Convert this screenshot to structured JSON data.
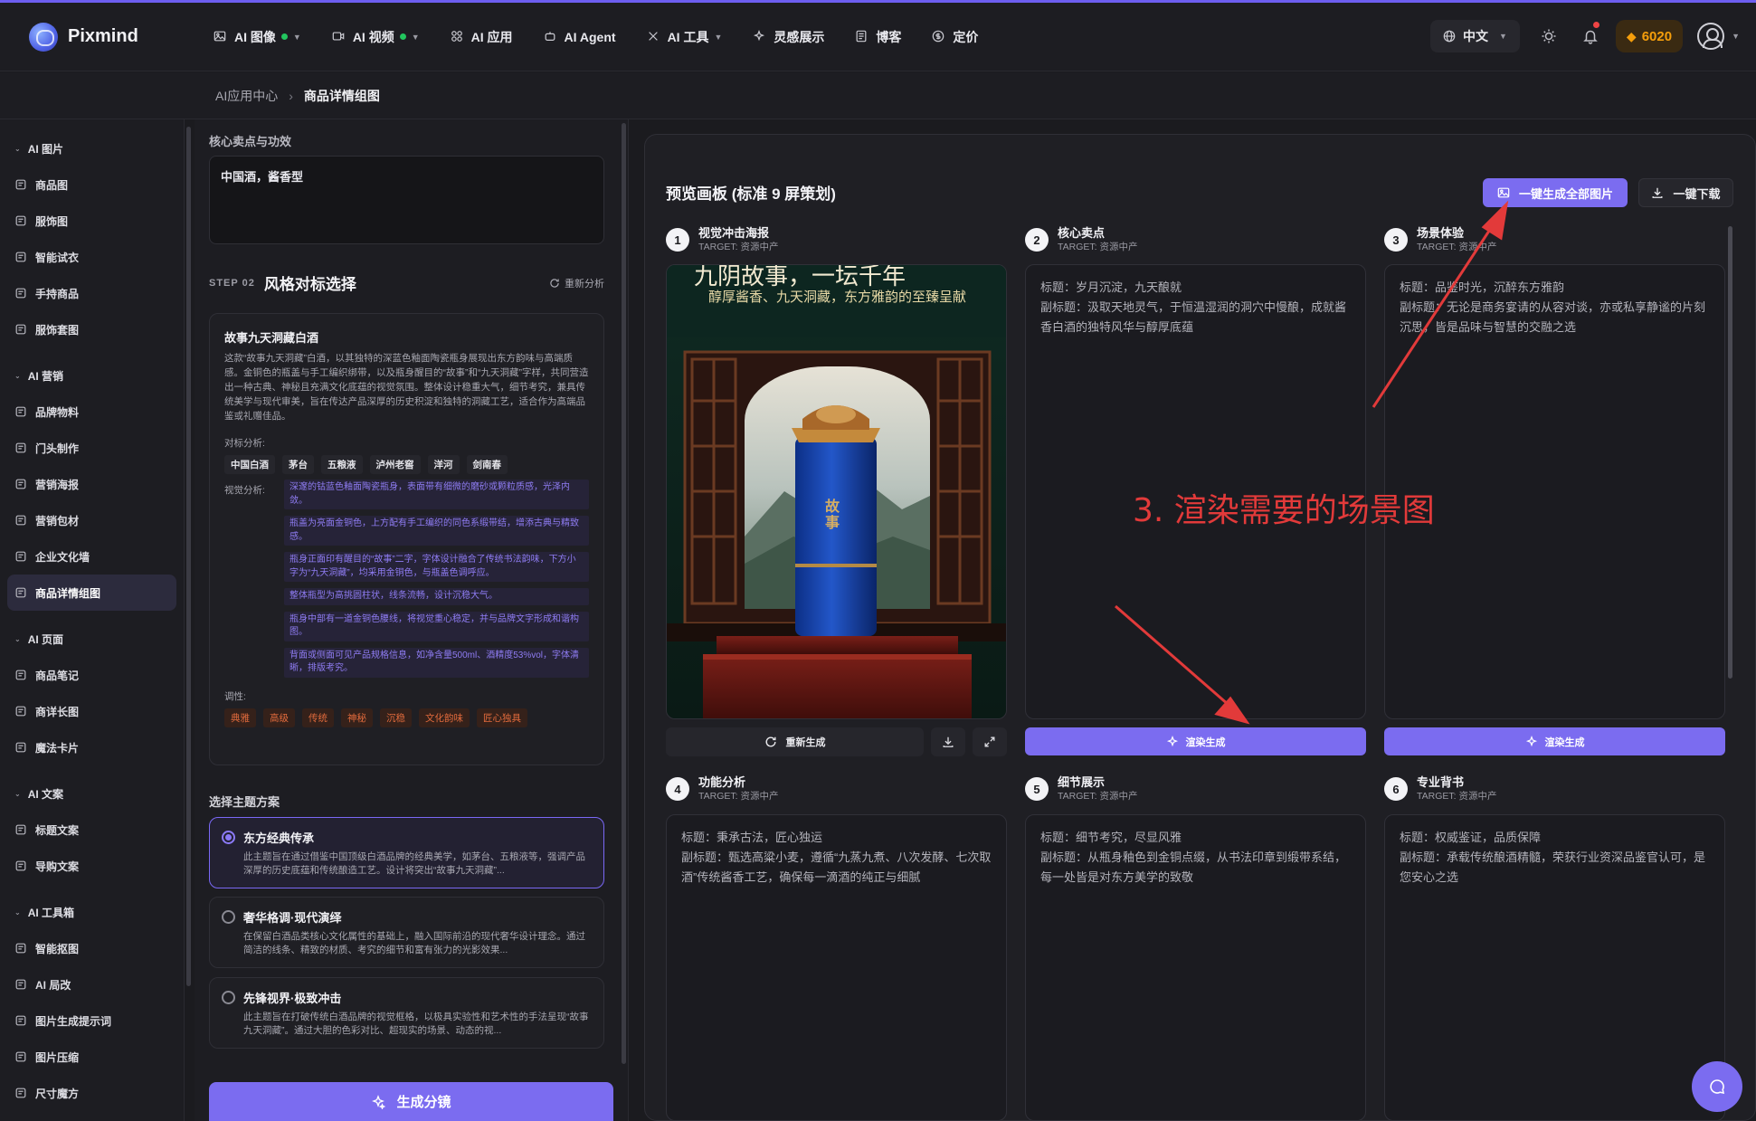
{
  "brand": {
    "name": "Pixmind"
  },
  "nav": {
    "items": [
      {
        "label": "AI 图像",
        "icon": "image-icon",
        "dot": true,
        "chevron": true
      },
      {
        "label": "AI 视频",
        "icon": "video-icon",
        "dot": true,
        "chevron": true
      },
      {
        "label": "AI 应用",
        "icon": "apps-icon",
        "dot": false,
        "chevron": false
      },
      {
        "label": "AI Agent",
        "icon": "robot-icon",
        "dot": false,
        "chevron": false
      },
      {
        "label": "AI 工具",
        "icon": "tools-icon",
        "dot": false,
        "chevron": true
      },
      {
        "label": "灵感展示",
        "icon": "sparkle-icon",
        "dot": false,
        "chevron": false
      },
      {
        "label": "博客",
        "icon": "blog-icon",
        "dot": false,
        "chevron": false
      },
      {
        "label": "定价",
        "icon": "price-icon",
        "dot": false,
        "chevron": false
      }
    ],
    "language": "中文",
    "credits": "6020"
  },
  "breadcrumb": {
    "parent": "AI应用中心",
    "current": "商品详情组图"
  },
  "sidebar": {
    "groups": [
      {
        "label": "AI 图片",
        "items": [
          {
            "label": "商品图",
            "icon": "product-icon"
          },
          {
            "label": "服饰图",
            "icon": "shirt-icon"
          },
          {
            "label": "智能试衣",
            "icon": "hanger-icon"
          },
          {
            "label": "手持商品",
            "icon": "hand-icon"
          },
          {
            "label": "服饰套图",
            "icon": "grid-icon"
          }
        ]
      },
      {
        "label": "AI 营销",
        "items": [
          {
            "label": "品牌物料",
            "icon": "palette-icon"
          },
          {
            "label": "门头制作",
            "icon": "storefront-icon"
          },
          {
            "label": "营销海报",
            "icon": "poster-icon"
          },
          {
            "label": "营销包材",
            "icon": "package-icon"
          },
          {
            "label": "企业文化墙",
            "icon": "wall-icon"
          },
          {
            "label": "商品详情组图",
            "icon": "gallery-icon",
            "active": true
          }
        ]
      },
      {
        "label": "AI 页面",
        "items": [
          {
            "label": "商品笔记",
            "icon": "note-icon"
          },
          {
            "label": "商详长图",
            "icon": "longpage-icon"
          },
          {
            "label": "魔法卡片",
            "icon": "magic-icon"
          }
        ]
      },
      {
        "label": "AI 文案",
        "items": [
          {
            "label": "标题文案",
            "icon": "pen-icon"
          },
          {
            "label": "导购文案",
            "icon": "doc-icon"
          }
        ]
      },
      {
        "label": "AI 工具箱",
        "items": [
          {
            "label": "智能抠图",
            "icon": "scissors-icon"
          },
          {
            "label": "AI 局改",
            "icon": "brush-icon"
          },
          {
            "label": "图片生成提示词",
            "icon": "bulb-icon"
          },
          {
            "label": "图片压缩",
            "icon": "compress-icon"
          },
          {
            "label": "尺寸魔方",
            "icon": "crop-icon"
          }
        ]
      }
    ]
  },
  "form": {
    "core_label": "核心卖点与功效",
    "core_value": "中国酒，酱香型",
    "step_small": "STEP 02",
    "step_title": "风格对标选择",
    "reanalyze": "重新分析",
    "analysis": {
      "title": "故事九天洞藏白酒",
      "desc": "这款“故事九天洞藏”白酒，以其独特的深蓝色釉面陶瓷瓶身展现出东方韵味与高端质感。金铜色的瓶盖与手工编织绑带，以及瓶身醒目的“故事”和“九天洞藏”字样，共同营造出一种古典、神秘且充满文化底蕴的视觉氛围。整体设计稳重大气，细节考究，兼具传统美学与现代审美，旨在传达产品深厚的历史积淀和独特的洞藏工艺，适合作为高端品鉴或礼赠佳品。",
      "competitors_label": "对标分析:",
      "competitors": [
        "中国白酒",
        "茅台",
        "五粮液",
        "泸州老窖",
        "洋河",
        "剑南春"
      ],
      "visual_label": "视觉分析:",
      "visual_items": [
        "深邃的钴蓝色釉面陶瓷瓶身，表面带有细微的磨砂或颗粒质感，光泽内敛。",
        "瓶盖为亮面金铜色，上方配有手工编织的同色系缎带结，增添古典与精致感。",
        "瓶身正面印有醒目的“故事”二字，字体设计融合了传统书法韵味，下方小字为“九天洞藏”，均采用金铜色，与瓶盖色调呼应。",
        "整体瓶型为高挑圆柱状，线条流畅，设计沉稳大气。",
        "瓶身中部有一道金铜色腰线，将视觉重心稳定，并与品牌文字形成和谐构图。",
        "背面或侧面可见产品规格信息，如净含量500ml、酒精度53%vol，字体清晰，排版考究。"
      ],
      "tone_label": "调性:",
      "tones": [
        "典雅",
        "高级",
        "传统",
        "神秘",
        "沉稳",
        "文化韵味",
        "匠心独具"
      ]
    },
    "theme_label": "选择主题方案",
    "themes": [
      {
        "title": "东方经典传承",
        "desc": "此主题旨在通过借鉴中国顶级白酒品牌的经典美学，如茅台、五粮液等，强调产品深厚的历史底蕴和传统酿造工艺。设计将突出“故事九天洞藏”...",
        "selected": true
      },
      {
        "title": "奢华格调·现代演绎",
        "desc": "在保留白酒品类核心文化属性的基础上，融入国际前沿的现代奢华设计理念。通过简洁的线条、精致的材质、考究的细节和富有张力的光影效果...",
        "selected": false
      },
      {
        "title": "先锋视界·极致冲击",
        "desc": "此主题旨在打破传统白酒品牌的视觉框格，以极具实验性和艺术性的手法呈现“故事九天洞藏”。通过大胆的色彩对比、超现实的场景、动态的视...",
        "selected": false
      }
    ],
    "generate_button": "生成分镜"
  },
  "preview": {
    "title": "预览画板 (标准 9 屏策划)",
    "generate_all": "一键生成全部图片",
    "download_all": "一键下载",
    "regenerate": "重新生成",
    "render_label": "渲染生成",
    "poster_text_top": "九阴故事，一坛千年",
    "poster_subtitle": "醇厚酱香、九天洞藏，东方雅韵的至臻呈献",
    "bottle_label": "故事",
    "cards": [
      {
        "num": "1",
        "title": "视觉冲击海报",
        "target": "TARGET: 资源中产",
        "headline": "",
        "subhead": ""
      },
      {
        "num": "2",
        "title": "核心卖点",
        "target": "TARGET: 资源中产",
        "headline": "标题：岁月沉淀，九天酿就",
        "subhead": "副标题：汲取天地灵气，于恒温湿润的洞穴中慢酿，成就酱香白酒的独特风华与醇厚底蕴"
      },
      {
        "num": "3",
        "title": "场景体验",
        "target": "TARGET: 资源中产",
        "headline": "标题：品鉴时光，沉醉东方雅韵",
        "subhead": "副标题：无论是商务宴请的从容对谈，亦或私享静谧的片刻沉思，皆是品味与智慧的交融之选"
      },
      {
        "num": "4",
        "title": "功能分析",
        "target": "TARGET: 资源中产",
        "headline": "标题：秉承古法，匠心独运",
        "subhead": "副标题：甄选高粱小麦，遵循“九蒸九煮、八次发酵、七次取酒”传统酱香工艺，确保每一滴酒的纯正与细腻"
      },
      {
        "num": "5",
        "title": "细节展示",
        "target": "TARGET: 资源中产",
        "headline": "标题：细节考究，尽显风雅",
        "subhead": "副标题：从瓶身釉色到金铜点缀，从书法印章到缎带系结，每一处皆是对东方美学的致敬"
      },
      {
        "num": "6",
        "title": "专业背书",
        "target": "TARGET: 资源中产",
        "headline": "标题：权威鉴证，品质保障",
        "subhead": "副标题：承载传统酿酒精髓，荣获行业资深品鉴官认可，是您安心之选"
      }
    ]
  },
  "annotation": {
    "text": "3. 渲染需要的场景图",
    "color": "#e23a3a"
  },
  "colors": {
    "accent": "#7b6cf0",
    "background": "#1b1b1f",
    "credits": "#f59e0b",
    "annotation": "#e23a3a"
  }
}
